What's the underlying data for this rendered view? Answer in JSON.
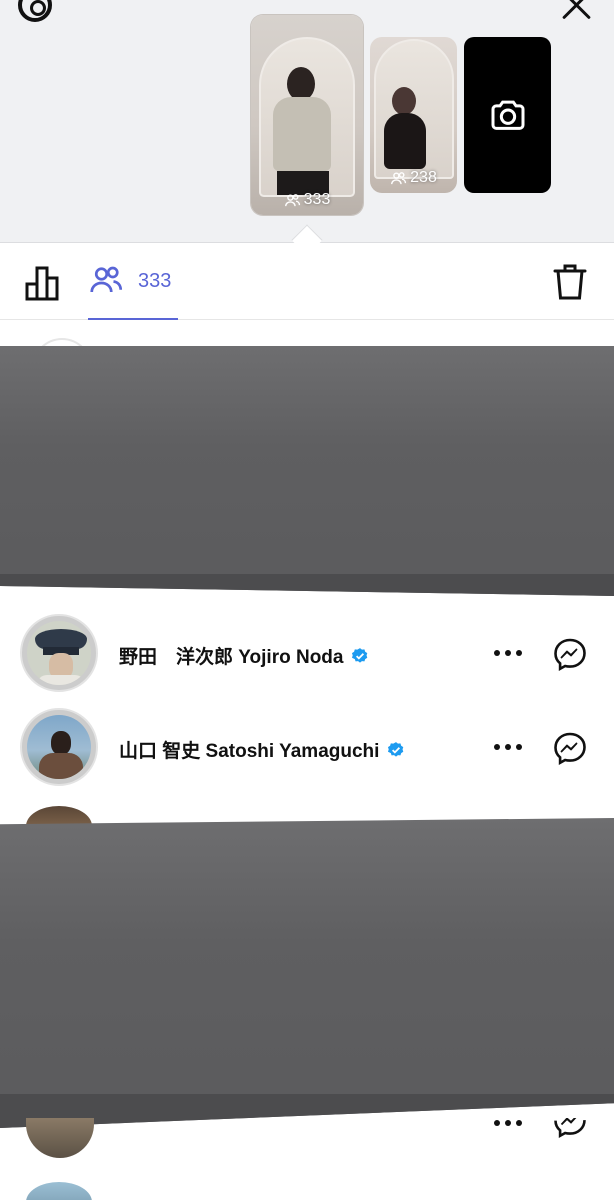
{
  "stories": [
    {
      "viewers": "333",
      "selected": true
    },
    {
      "viewers": "238",
      "selected": false
    }
  ],
  "toolbar": {
    "insights_icon": "bar-chart-icon",
    "viewers_icon": "people-icon",
    "viewers_count": "333",
    "delete_icon": "trash-icon"
  },
  "viewers": [
    {
      "name": "野田　洋次郎  Yojiro Noda",
      "verified": true,
      "more_icon": "more-icon",
      "message_icon": "messenger-icon"
    },
    {
      "name": "山口 智史 Satoshi Yamaguchi",
      "verified": true,
      "more_icon": "more-icon",
      "message_icon": "messenger-icon"
    }
  ],
  "colors": {
    "accent": "#5965d6",
    "verified": "#1d9bf0",
    "redaction": "#5f5f61"
  }
}
